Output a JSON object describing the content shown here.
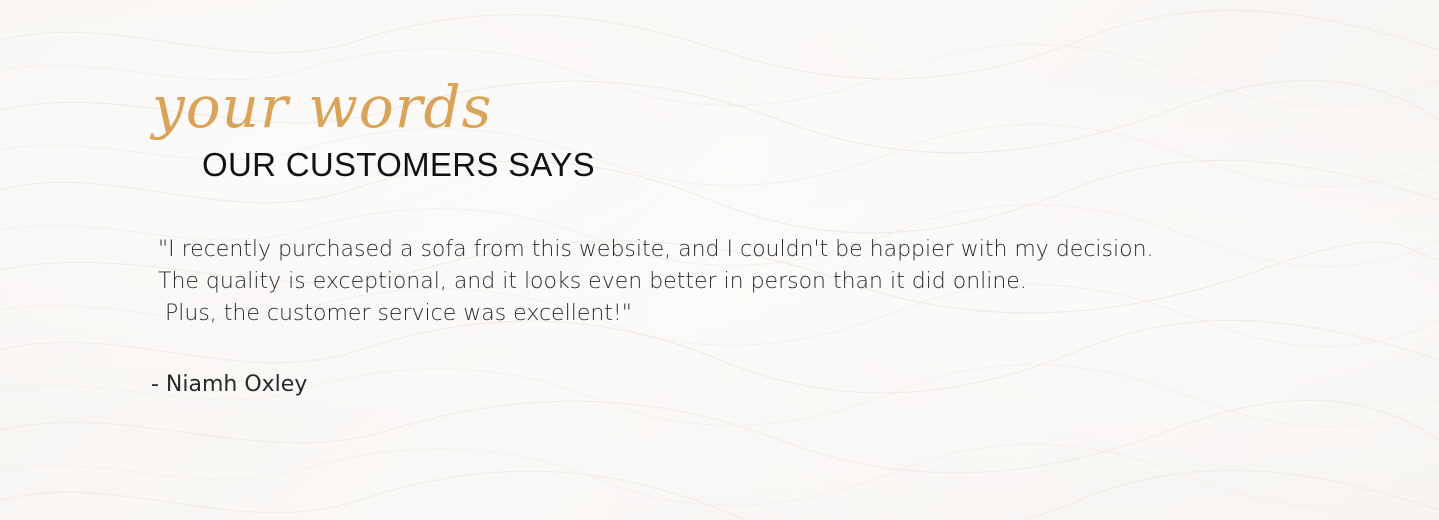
{
  "background": {
    "color": "#f8f6f4",
    "texture": "subtle wave pattern"
  },
  "testimonial_section": {
    "script_title": "your words",
    "title": "OUR CUSTOMERS SAYS",
    "quote_lines": [
      "\"I recently purchased a sofa from this website, and I couldn't be happier with my decision.",
      "The quality is exceptional, and it looks even better in person than it did online.",
      " Plus, the customer service was excellent!\""
    ],
    "author": "- Niamh Oxley"
  },
  "colors": {
    "accent": "#d9a45a",
    "text": "#2a2a2a",
    "title": "#111111"
  }
}
